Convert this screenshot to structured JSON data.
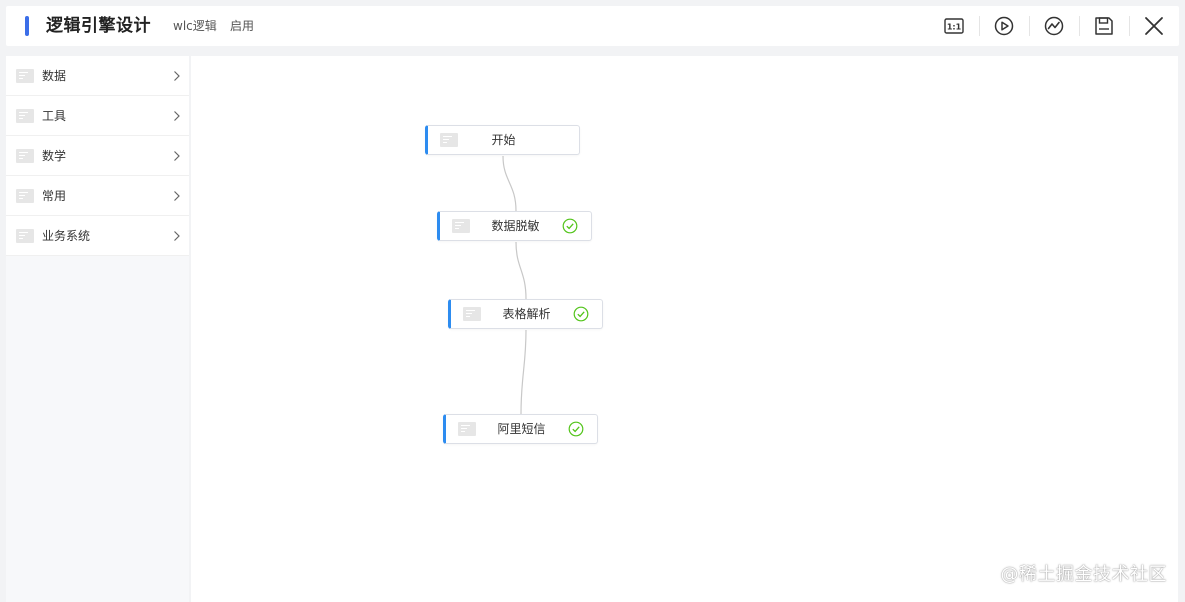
{
  "header": {
    "title": "逻辑引擎设计",
    "logic_name": "wlc逻辑",
    "status": "启用",
    "toolbar": [
      {
        "icon": "fit-view-icon",
        "label": "1:1"
      },
      {
        "icon": "play-icon"
      },
      {
        "icon": "trend-icon"
      },
      {
        "icon": "save-icon"
      },
      {
        "icon": "close-icon"
      }
    ]
  },
  "sidebar": {
    "categories": [
      {
        "label": "数据"
      },
      {
        "label": "工具"
      },
      {
        "label": "数学"
      },
      {
        "label": "常用"
      },
      {
        "label": "业务系统"
      }
    ]
  },
  "canvas": {
    "nodes": [
      {
        "label": "开始",
        "checked": false
      },
      {
        "label": "数据脱敏",
        "checked": true
      },
      {
        "label": "表格解析",
        "checked": true
      },
      {
        "label": "阿里短信",
        "checked": true
      }
    ],
    "edge_color": "#c8c8c8",
    "check_color": "#52c41a"
  },
  "watermark": "@稀土掘金技术社区"
}
